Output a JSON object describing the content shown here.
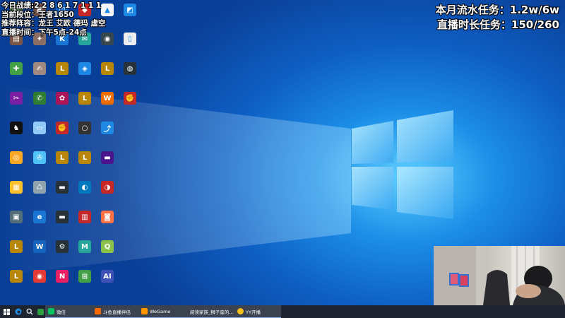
{
  "stream_overlay": {
    "left_lines": [
      "今日战绩:2 2 8 6 1 7 1 1 1",
      "当前段位：王者1650",
      "推荐阵容：龙王 艾欧 德玛 虚空",
      "直播时间：下午5点-24点"
    ],
    "right_lines": [
      "本月流水任务：1.2w/6w",
      "直播时长任务：150/260"
    ]
  },
  "desktop": {
    "icons": [
      {
        "label": "",
        "color": "#2f7d32",
        "glyph": "◧"
      },
      {
        "label": "",
        "color": "#6d4c41",
        "glyph": "▣"
      },
      {
        "label": "",
        "color": "#1565c0",
        "glyph": "◫"
      },
      {
        "label": "",
        "color": "#c62828",
        "glyph": "◆"
      },
      {
        "label": "",
        "color": "#f5f5f5",
        "glyph": "▲"
      },
      {
        "label": "",
        "color": "#1e88e5",
        "glyph": "◩"
      },
      {
        "label": "",
        "color": "#795548",
        "glyph": "▤"
      },
      {
        "label": "",
        "color": "#8d6e63",
        "glyph": "✦"
      },
      {
        "label": "",
        "color": "#1976d2",
        "glyph": "K"
      },
      {
        "label": "",
        "color": "#26a69a",
        "glyph": "✉"
      },
      {
        "label": "",
        "color": "#37474f",
        "glyph": "◉"
      },
      {
        "label": "",
        "color": "#eeeeee",
        "glyph": "▯"
      },
      {
        "label": "",
        "color": "#43a047",
        "glyph": "✚"
      },
      {
        "label": "",
        "color": "#a1887f",
        "glyph": "✍"
      },
      {
        "label": "",
        "color": "#b8860b",
        "glyph": "L"
      },
      {
        "label": "",
        "color": "#1e88e5",
        "glyph": "◈"
      },
      {
        "label": "",
        "color": "#b8860b",
        "glyph": "L"
      },
      {
        "label": "",
        "color": "#263238",
        "glyph": "◍"
      },
      {
        "label": "",
        "color": "#7b1fa2",
        "glyph": "✂"
      },
      {
        "label": "",
        "color": "#2e7d32",
        "glyph": "✆"
      },
      {
        "label": "",
        "color": "#ad1457",
        "glyph": "✿"
      },
      {
        "label": "",
        "color": "#b8860b",
        "glyph": "L"
      },
      {
        "label": "",
        "color": "#ef6c00",
        "glyph": "W"
      },
      {
        "label": "",
        "color": "#c62828",
        "glyph": "✊"
      },
      {
        "label": "",
        "color": "#111111",
        "glyph": "♞"
      },
      {
        "label": "",
        "color": "#90caf9",
        "glyph": "▭"
      },
      {
        "label": "",
        "color": "#c62828",
        "glyph": "✊"
      },
      {
        "label": "",
        "color": "#333333",
        "glyph": "○"
      },
      {
        "label": "",
        "color": "#1e88e5",
        "glyph": "⤴"
      },
      {
        "label": "",
        "color": "#f9a825",
        "glyph": "◎"
      },
      {
        "label": "",
        "color": "#4fc3f7",
        "glyph": "✇"
      },
      {
        "label": "",
        "color": "#b8860b",
        "glyph": "L"
      },
      {
        "label": "",
        "color": "#b8860b",
        "glyph": "L"
      },
      {
        "label": "",
        "color": "#4a148c",
        "glyph": "▬"
      },
      {
        "label": "",
        "color": "#fbc02d",
        "glyph": "▦"
      },
      {
        "label": "",
        "color": "#90a4ae",
        "glyph": "♺"
      },
      {
        "label": "",
        "color": "#263238",
        "glyph": "▬"
      },
      {
        "label": "",
        "color": "#0277bd",
        "glyph": "◐"
      },
      {
        "label": "",
        "color": "#c62828",
        "glyph": "◑"
      },
      {
        "label": "",
        "color": "#546e7a",
        "glyph": "▣"
      },
      {
        "label": "",
        "color": "#1976d2",
        "glyph": "e"
      },
      {
        "label": "",
        "color": "#263238",
        "glyph": "▬"
      },
      {
        "label": "",
        "color": "#c62828",
        "glyph": "▥"
      },
      {
        "label": "",
        "color": "#ff7043",
        "glyph": "◙"
      },
      {
        "label": "",
        "color": "#b8860b",
        "glyph": "L"
      },
      {
        "label": "",
        "color": "#1565c0",
        "glyph": "W"
      },
      {
        "label": "",
        "color": "#263238",
        "glyph": "⚙"
      },
      {
        "label": "",
        "color": "#26a69a",
        "glyph": "M"
      },
      {
        "label": "",
        "color": "#8bc34a",
        "glyph": "Q"
      },
      {
        "label": "",
        "color": "#b8860b",
        "glyph": "L"
      },
      {
        "label": "",
        "color": "#e53935",
        "glyph": "◉"
      },
      {
        "label": "",
        "color": "#e91e63",
        "glyph": "N"
      },
      {
        "label": "",
        "color": "#43a047",
        "glyph": "⊞"
      },
      {
        "label": "",
        "color": "#3f51b5",
        "glyph": "AI"
      }
    ]
  },
  "taskbar": {
    "apps": [
      {
        "label": "微信",
        "icon_color": "#07c160"
      },
      {
        "label": "斗鱼直播伴侣",
        "icon_color": "#ff6a00"
      },
      {
        "label": "WeGame",
        "icon_color": "#ff9800"
      },
      {
        "label": "阅读家族_狮子座的...",
        "icon_color": "#1e88e5"
      },
      {
        "label": "YY开播",
        "icon_color": "#f9c21b"
      }
    ]
  }
}
